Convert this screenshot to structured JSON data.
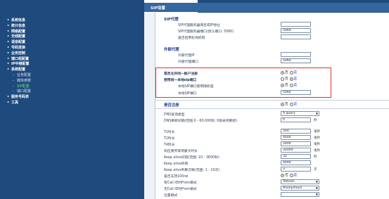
{
  "header": {
    "title": "SIP设置"
  },
  "sidebar": {
    "items": [
      {
        "label": "系统信息",
        "sub": false
      },
      {
        "label": "统计信息",
        "sub": false
      },
      {
        "label": "网络配置",
        "sub": false
      },
      {
        "label": "无线配置",
        "sub": false
      },
      {
        "label": "语音配置",
        "sub": false
      },
      {
        "label": "号码变换",
        "sub": false
      },
      {
        "label": "业务控制",
        "sub": false
      },
      {
        "label": "端口组配置",
        "sub": false
      },
      {
        "label": "IP中继配置",
        "sub": false
      },
      {
        "label": "系统配置",
        "sub": false
      },
      {
        "label": "业务配置",
        "sub": true,
        "active": false
      },
      {
        "label": "媒体参数",
        "sub": true,
        "active": false
      },
      {
        "label": "SIP配置",
        "sub": true,
        "active": true
      },
      {
        "label": "端口配置",
        "sub": true,
        "active": false
      },
      {
        "label": "服务号码表",
        "sub": false
      },
      {
        "label": "工具",
        "sub": false
      }
    ]
  },
  "sip_proxy": {
    "title": "SIP代理",
    "addr_label": "SIP代理服务器域名或IP地址",
    "addr_value": "",
    "port_label": "SIP代理服务器端口(默认端口: 5060)",
    "port_value": "5060",
    "poll_label": "是否启用轮询机制",
    "poll_value": ""
  },
  "outbound_proxy": {
    "title": "外部代理",
    "ip_label": "外部代理IP",
    "ip_value": "",
    "port_label": "外部代理端口",
    "port_value": "5060"
  },
  "port_options": {
    "allow_unified_label": "是否允许同一账户注册",
    "use_same_port_label": "使用同一本地sip端口",
    "random_port_label": "本地SIP端口使用随机值",
    "local_port_label": "本地SIP端口",
    "local_port_value": "5060",
    "no": "否",
    "yes": "是"
  },
  "register": {
    "title": "是否注册",
    "dns_type_label": "DNS查询类型",
    "dns_type_value": "A query",
    "dns_refresh_label": "DNS刷新间隔(范围:0 - 60,000秒; 0指关闭刷新)",
    "dns_refresh_value": "0",
    "t1_label": "T1时长",
    "t1_value": "500",
    "t2_label": "T2时长",
    "t2_value": "4000",
    "t4_label": "T4时长",
    "t4_value": "5000",
    "max_wait_label": "响应重传等待最大时长",
    "max_wait_value": "32000",
    "keepalive_interval_label": "Keep alive间隔(范围: 10 - 3600秒)",
    "keepalive_interval_value": "32",
    "keepalive_label": "Keep alive机制",
    "keepalive_value": "4000",
    "keepalive_count_label": "Keep alive判断次数(范围: 1 - 10次)",
    "keepalive_count_value": "3",
    "support_100rel_label": "是否支持100rel",
    "with_callid_label": "有Call ID时From模式",
    "with_callid_value": "TelUser",
    "without_callid_label": "无Call ID时From模式",
    "without_callid_value": "Anonymous",
    "position_label": "位置模式",
    "position_value": "",
    "unit_ms": "毫秒",
    "unit_s": "秒",
    "unit_times": "次"
  }
}
